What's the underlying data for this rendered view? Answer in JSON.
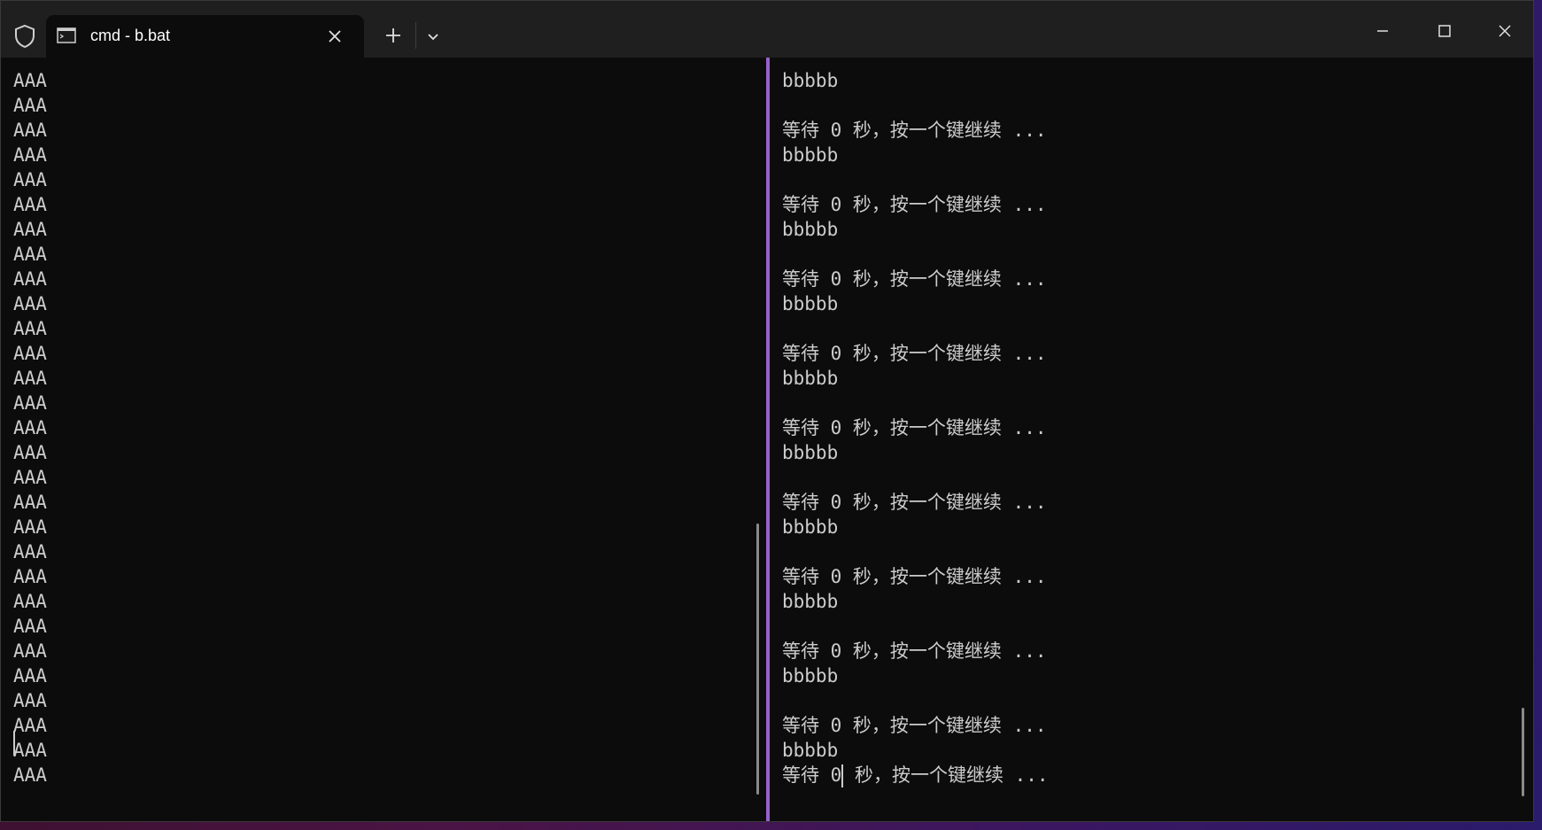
{
  "titlebar": {
    "tab_title": "cmd - b.bat"
  },
  "icons": {
    "shield": "shield-icon",
    "tab": "terminal-icon",
    "close_tab": "close-icon",
    "new_tab": "plus-icon",
    "dropdown": "chevron-down-icon",
    "minimize": "minimize-icon",
    "maximize": "maximize-icon",
    "close_window": "close-icon"
  },
  "colors": {
    "divider": "#9a5fd0",
    "terminal_bg": "#0c0c0c",
    "terminal_text": "#cccccc"
  },
  "left_pane": {
    "lines": [
      "AAA",
      "AAA",
      "AAA",
      "AAA",
      "AAA",
      "AAA",
      "AAA",
      "AAA",
      "AAA",
      "AAA",
      "AAA",
      "AAA",
      "AAA",
      "AAA",
      "AAA",
      "AAA",
      "AAA",
      "AAA",
      "AAA",
      "AAA",
      "AAA",
      "AAA",
      "AAA",
      "AAA",
      "AAA",
      "AAA",
      "AAA",
      "AAA",
      "AAA"
    ]
  },
  "right_pane": {
    "lines": [
      "bbbbb",
      "",
      "等待 0 秒，按一个键继续 ...",
      "bbbbb",
      "",
      "等待 0 秒，按一个键继续 ...",
      "bbbbb",
      "",
      "等待 0 秒，按一个键继续 ...",
      "bbbbb",
      "",
      "等待 0 秒，按一个键继续 ...",
      "bbbbb",
      "",
      "等待 0 秒，按一个键继续 ...",
      "bbbbb",
      "",
      "等待 0 秒，按一个键继续 ...",
      "bbbbb",
      "",
      "等待 0 秒，按一个键继续 ...",
      "bbbbb",
      "",
      "等待 0 秒，按一个键继续 ...",
      "bbbbb",
      "",
      "等待 0 秒，按一个键继续 ...",
      "bbbbb",
      ""
    ],
    "last_line_before_cursor": "等待 0",
    "last_line_after_cursor": " 秒，按一个键继续 ..."
  }
}
